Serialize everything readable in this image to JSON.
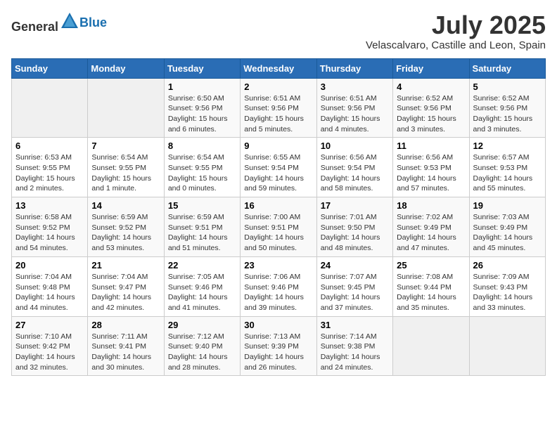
{
  "header": {
    "logo_general": "General",
    "logo_blue": "Blue",
    "title": "July 2025",
    "subtitle": "Velascalvaro, Castille and Leon, Spain"
  },
  "weekdays": [
    "Sunday",
    "Monday",
    "Tuesday",
    "Wednesday",
    "Thursday",
    "Friday",
    "Saturday"
  ],
  "weeks": [
    [
      {
        "day": "",
        "sunrise": "",
        "sunset": "",
        "daylight": ""
      },
      {
        "day": "",
        "sunrise": "",
        "sunset": "",
        "daylight": ""
      },
      {
        "day": "1",
        "sunrise": "Sunrise: 6:50 AM",
        "sunset": "Sunset: 9:56 PM",
        "daylight": "Daylight: 15 hours and 6 minutes."
      },
      {
        "day": "2",
        "sunrise": "Sunrise: 6:51 AM",
        "sunset": "Sunset: 9:56 PM",
        "daylight": "Daylight: 15 hours and 5 minutes."
      },
      {
        "day": "3",
        "sunrise": "Sunrise: 6:51 AM",
        "sunset": "Sunset: 9:56 PM",
        "daylight": "Daylight: 15 hours and 4 minutes."
      },
      {
        "day": "4",
        "sunrise": "Sunrise: 6:52 AM",
        "sunset": "Sunset: 9:56 PM",
        "daylight": "Daylight: 15 hours and 3 minutes."
      },
      {
        "day": "5",
        "sunrise": "Sunrise: 6:52 AM",
        "sunset": "Sunset: 9:56 PM",
        "daylight": "Daylight: 15 hours and 3 minutes."
      }
    ],
    [
      {
        "day": "6",
        "sunrise": "Sunrise: 6:53 AM",
        "sunset": "Sunset: 9:55 PM",
        "daylight": "Daylight: 15 hours and 2 minutes."
      },
      {
        "day": "7",
        "sunrise": "Sunrise: 6:54 AM",
        "sunset": "Sunset: 9:55 PM",
        "daylight": "Daylight: 15 hours and 1 minute."
      },
      {
        "day": "8",
        "sunrise": "Sunrise: 6:54 AM",
        "sunset": "Sunset: 9:55 PM",
        "daylight": "Daylight: 15 hours and 0 minutes."
      },
      {
        "day": "9",
        "sunrise": "Sunrise: 6:55 AM",
        "sunset": "Sunset: 9:54 PM",
        "daylight": "Daylight: 14 hours and 59 minutes."
      },
      {
        "day": "10",
        "sunrise": "Sunrise: 6:56 AM",
        "sunset": "Sunset: 9:54 PM",
        "daylight": "Daylight: 14 hours and 58 minutes."
      },
      {
        "day": "11",
        "sunrise": "Sunrise: 6:56 AM",
        "sunset": "Sunset: 9:53 PM",
        "daylight": "Daylight: 14 hours and 57 minutes."
      },
      {
        "day": "12",
        "sunrise": "Sunrise: 6:57 AM",
        "sunset": "Sunset: 9:53 PM",
        "daylight": "Daylight: 14 hours and 55 minutes."
      }
    ],
    [
      {
        "day": "13",
        "sunrise": "Sunrise: 6:58 AM",
        "sunset": "Sunset: 9:52 PM",
        "daylight": "Daylight: 14 hours and 54 minutes."
      },
      {
        "day": "14",
        "sunrise": "Sunrise: 6:59 AM",
        "sunset": "Sunset: 9:52 PM",
        "daylight": "Daylight: 14 hours and 53 minutes."
      },
      {
        "day": "15",
        "sunrise": "Sunrise: 6:59 AM",
        "sunset": "Sunset: 9:51 PM",
        "daylight": "Daylight: 14 hours and 51 minutes."
      },
      {
        "day": "16",
        "sunrise": "Sunrise: 7:00 AM",
        "sunset": "Sunset: 9:51 PM",
        "daylight": "Daylight: 14 hours and 50 minutes."
      },
      {
        "day": "17",
        "sunrise": "Sunrise: 7:01 AM",
        "sunset": "Sunset: 9:50 PM",
        "daylight": "Daylight: 14 hours and 48 minutes."
      },
      {
        "day": "18",
        "sunrise": "Sunrise: 7:02 AM",
        "sunset": "Sunset: 9:49 PM",
        "daylight": "Daylight: 14 hours and 47 minutes."
      },
      {
        "day": "19",
        "sunrise": "Sunrise: 7:03 AM",
        "sunset": "Sunset: 9:49 PM",
        "daylight": "Daylight: 14 hours and 45 minutes."
      }
    ],
    [
      {
        "day": "20",
        "sunrise": "Sunrise: 7:04 AM",
        "sunset": "Sunset: 9:48 PM",
        "daylight": "Daylight: 14 hours and 44 minutes."
      },
      {
        "day": "21",
        "sunrise": "Sunrise: 7:04 AM",
        "sunset": "Sunset: 9:47 PM",
        "daylight": "Daylight: 14 hours and 42 minutes."
      },
      {
        "day": "22",
        "sunrise": "Sunrise: 7:05 AM",
        "sunset": "Sunset: 9:46 PM",
        "daylight": "Daylight: 14 hours and 41 minutes."
      },
      {
        "day": "23",
        "sunrise": "Sunrise: 7:06 AM",
        "sunset": "Sunset: 9:46 PM",
        "daylight": "Daylight: 14 hours and 39 minutes."
      },
      {
        "day": "24",
        "sunrise": "Sunrise: 7:07 AM",
        "sunset": "Sunset: 9:45 PM",
        "daylight": "Daylight: 14 hours and 37 minutes."
      },
      {
        "day": "25",
        "sunrise": "Sunrise: 7:08 AM",
        "sunset": "Sunset: 9:44 PM",
        "daylight": "Daylight: 14 hours and 35 minutes."
      },
      {
        "day": "26",
        "sunrise": "Sunrise: 7:09 AM",
        "sunset": "Sunset: 9:43 PM",
        "daylight": "Daylight: 14 hours and 33 minutes."
      }
    ],
    [
      {
        "day": "27",
        "sunrise": "Sunrise: 7:10 AM",
        "sunset": "Sunset: 9:42 PM",
        "daylight": "Daylight: 14 hours and 32 minutes."
      },
      {
        "day": "28",
        "sunrise": "Sunrise: 7:11 AM",
        "sunset": "Sunset: 9:41 PM",
        "daylight": "Daylight: 14 hours and 30 minutes."
      },
      {
        "day": "29",
        "sunrise": "Sunrise: 7:12 AM",
        "sunset": "Sunset: 9:40 PM",
        "daylight": "Daylight: 14 hours and 28 minutes."
      },
      {
        "day": "30",
        "sunrise": "Sunrise: 7:13 AM",
        "sunset": "Sunset: 9:39 PM",
        "daylight": "Daylight: 14 hours and 26 minutes."
      },
      {
        "day": "31",
        "sunrise": "Sunrise: 7:14 AM",
        "sunset": "Sunset: 9:38 PM",
        "daylight": "Daylight: 14 hours and 24 minutes."
      },
      {
        "day": "",
        "sunrise": "",
        "sunset": "",
        "daylight": ""
      },
      {
        "day": "",
        "sunrise": "",
        "sunset": "",
        "daylight": ""
      }
    ]
  ]
}
